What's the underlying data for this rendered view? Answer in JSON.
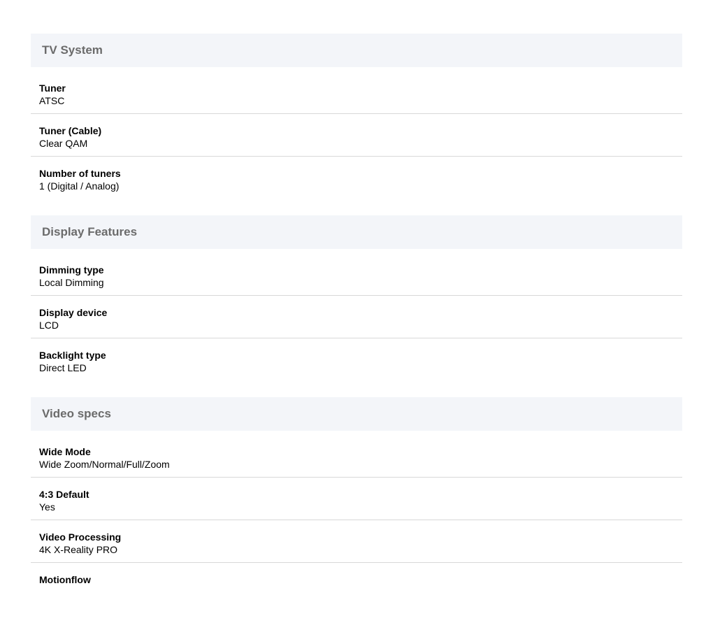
{
  "sections": [
    {
      "title": "TV System",
      "items": [
        {
          "label": "Tuner",
          "value": "ATSC"
        },
        {
          "label": "Tuner (Cable)",
          "value": "Clear QAM"
        },
        {
          "label": "Number of tuners",
          "value": "1 (Digital / Analog)"
        }
      ]
    },
    {
      "title": "Display Features",
      "items": [
        {
          "label": "Dimming type",
          "value": "Local Dimming"
        },
        {
          "label": "Display device",
          "value": "LCD"
        },
        {
          "label": "Backlight type",
          "value": "Direct LED"
        }
      ]
    },
    {
      "title": "Video specs",
      "items": [
        {
          "label": "Wide Mode",
          "value": "Wide Zoom/Normal/Full/Zoom"
        },
        {
          "label": "4:3 Default",
          "value": "Yes"
        },
        {
          "label": "Video Processing",
          "value": "4K X-Reality PRO"
        },
        {
          "label": "Motionflow",
          "value": ""
        }
      ]
    }
  ]
}
